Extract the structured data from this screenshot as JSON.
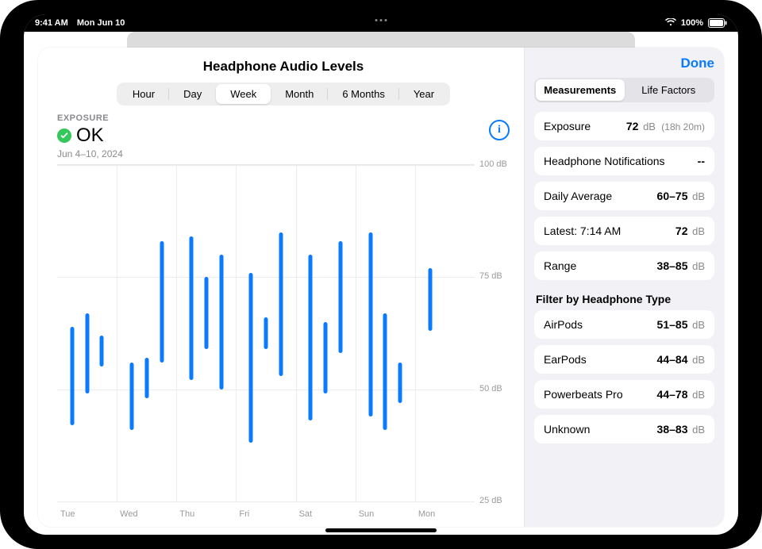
{
  "status_bar": {
    "time": "9:41 AM",
    "date": "Mon Jun 10",
    "battery_pct": "100%"
  },
  "header": {
    "title": "Headphone Audio Levels",
    "done": "Done"
  },
  "time_segments": [
    "Hour",
    "Day",
    "Week",
    "Month",
    "6 Months",
    "Year"
  ],
  "time_selected_index": 2,
  "exposure": {
    "label": "EXPOSURE",
    "status": "OK",
    "date_range": "Jun 4–10, 2024",
    "info_glyph": "i"
  },
  "side_tabs": {
    "left": "Measurements",
    "right": "Life Factors",
    "selected": "left"
  },
  "measurements": [
    {
      "label": "Exposure",
      "value": "72",
      "unit": "dB",
      "sub": "(18h 20m)"
    },
    {
      "label": "Headphone Notifications",
      "value": "--",
      "unit": "",
      "sub": ""
    },
    {
      "label": "Daily Average",
      "value": "60–75",
      "unit": "dB",
      "sub": ""
    },
    {
      "label": "Latest: 7:14 AM",
      "value": "72",
      "unit": "dB",
      "sub": ""
    },
    {
      "label": "Range",
      "value": "38–85",
      "unit": "dB",
      "sub": ""
    }
  ],
  "filter_header": "Filter by Headphone Type",
  "filters": [
    {
      "label": "AirPods",
      "value": "51–85",
      "unit": "dB"
    },
    {
      "label": "EarPods",
      "value": "44–84",
      "unit": "dB"
    },
    {
      "label": "Powerbeats Pro",
      "value": "44–78",
      "unit": "dB"
    },
    {
      "label": "Unknown",
      "value": "38–83",
      "unit": "dB"
    }
  ],
  "chart_data": {
    "type": "range-bar",
    "title": "Headphone Audio Levels",
    "xlabel": "",
    "ylabel": "dB",
    "ylim": [
      25,
      100
    ],
    "yticks": [
      25,
      50,
      75,
      100
    ],
    "ytick_labels": [
      "25 dB",
      "50 dB",
      "75 dB",
      "100 dB"
    ],
    "day_labels": [
      "Tue",
      "Wed",
      "Thu",
      "Fri",
      "Sat",
      "Sun",
      "Mon"
    ],
    "bars_per_day": 3,
    "series": [
      {
        "day": "Tue",
        "slot": 0,
        "low": 42,
        "high": 64
      },
      {
        "day": "Tue",
        "slot": 1,
        "low": 49,
        "high": 67
      },
      {
        "day": "Tue",
        "slot": 2,
        "low": 55,
        "high": 62
      },
      {
        "day": "Wed",
        "slot": 0,
        "low": 41,
        "high": 56
      },
      {
        "day": "Wed",
        "slot": 1,
        "low": 48,
        "high": 57
      },
      {
        "day": "Wed",
        "slot": 2,
        "low": 56,
        "high": 83
      },
      {
        "day": "Thu",
        "slot": 0,
        "low": 52,
        "high": 84
      },
      {
        "day": "Thu",
        "slot": 1,
        "low": 59,
        "high": 75
      },
      {
        "day": "Thu",
        "slot": 2,
        "low": 50,
        "high": 80
      },
      {
        "day": "Fri",
        "slot": 0,
        "low": 38,
        "high": 76
      },
      {
        "day": "Fri",
        "slot": 1,
        "low": 59,
        "high": 66
      },
      {
        "day": "Fri",
        "slot": 2,
        "low": 53,
        "high": 85
      },
      {
        "day": "Sat",
        "slot": 0,
        "low": 43,
        "high": 80
      },
      {
        "day": "Sat",
        "slot": 1,
        "low": 49,
        "high": 65
      },
      {
        "day": "Sat",
        "slot": 2,
        "low": 58,
        "high": 83
      },
      {
        "day": "Sun",
        "slot": 0,
        "low": 44,
        "high": 85
      },
      {
        "day": "Sun",
        "slot": 1,
        "low": 41,
        "high": 67
      },
      {
        "day": "Sun",
        "slot": 2,
        "low": 47,
        "high": 56
      },
      {
        "day": "Mon",
        "slot": 0,
        "low": 63,
        "high": 77
      }
    ]
  }
}
